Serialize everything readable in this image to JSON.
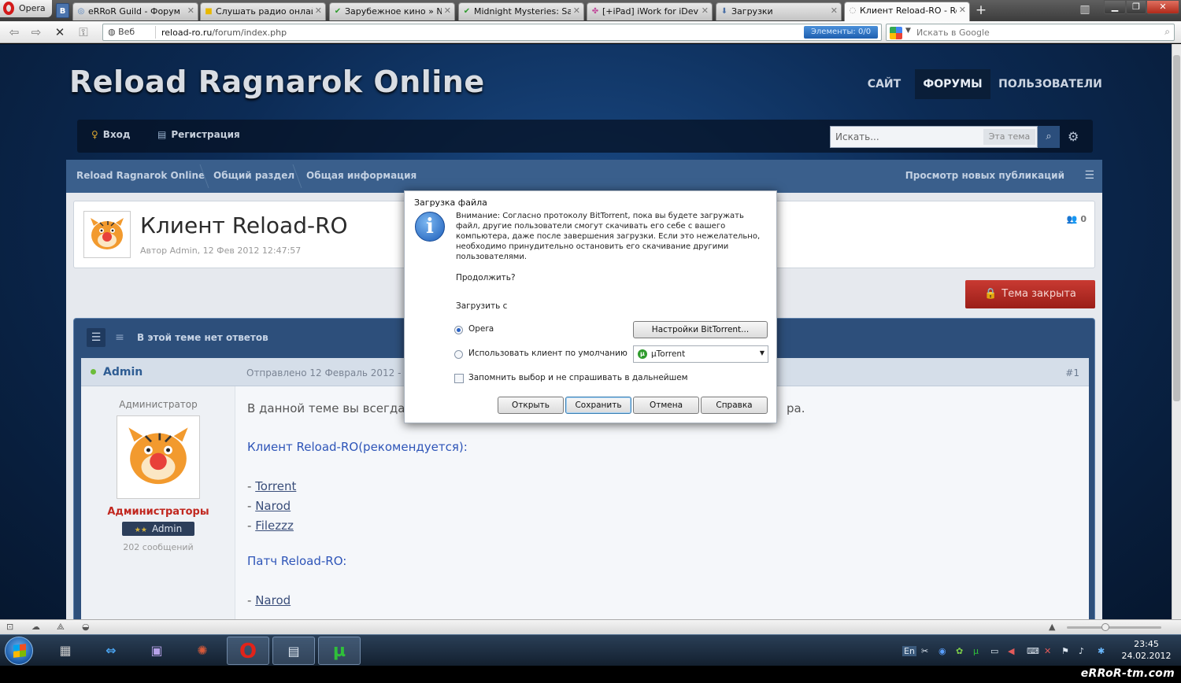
{
  "browser": {
    "menu_label": "Opera",
    "vk_label": "B",
    "tabs": [
      {
        "label": "eRRoR Guild - Форум",
        "icon": "globe-icon",
        "active": false
      },
      {
        "label": "Слушать радио онлай...",
        "icon": "folder-icon",
        "active": false
      },
      {
        "label": "Зарубежное кино » N...",
        "icon": "check-icon",
        "active": false
      },
      {
        "label": "Midnight Mysteries: Sal...",
        "icon": "check-icon",
        "active": false
      },
      {
        "label": "[+iPad] iWork for iDevi...",
        "icon": "puzzle-icon",
        "active": false
      },
      {
        "label": "Загрузки",
        "icon": "download-icon",
        "active": false
      },
      {
        "label": "Клиент Reload-RO - Re...",
        "icon": "loading-icon",
        "active": true
      }
    ],
    "address": {
      "web_label": "Веб",
      "url_domain": "reload-ro.ru",
      "url_path": "/forum/index.php",
      "elements_badge": "Элементы: 0/0"
    },
    "search": {
      "placeholder": "Искать в Google"
    }
  },
  "site": {
    "title": "Reload Ragnarok Online",
    "nav": [
      {
        "label": "САЙТ",
        "active": false
      },
      {
        "label": "ФОРУМЫ",
        "active": true
      },
      {
        "label": "ПОЛЬЗОВАТЕЛИ",
        "active": false
      }
    ],
    "login_label": "Вход",
    "register_label": "Регистрация",
    "search_placeholder": "Искать...",
    "search_scope": "Эта тема",
    "breadcrumb": [
      "Reload Ragnarok Online",
      "Общий раздел",
      "Общая информация"
    ],
    "new_posts_label": "Просмотр новых публикаций"
  },
  "topic": {
    "title": "Клиент Reload-RO",
    "meta": "Автор Admin, 12 Фев 2012 12:47:57",
    "viewers": "0",
    "closed_label": "Тема закрыта",
    "no_replies": "В этой теме нет ответов"
  },
  "post": {
    "author": "Admin",
    "date": "Отправлено 12 Февраль 2012 - 12",
    "number": "#1",
    "role_title": "Администратор",
    "group": "Администраторы",
    "rank": "Admin",
    "post_count": "202 сообщений",
    "intro_start": "В данной теме вы всегда",
    "intro_end": "ра.",
    "client_heading": "Клиент Reload-RO(рекомендуется):",
    "client_links": [
      "Torrent",
      "Narod",
      "Filezzz"
    ],
    "patch_heading": "Патч Reload-RO:",
    "patch_links": [
      "Narod"
    ]
  },
  "dialog": {
    "title": "Загрузка файла",
    "message": "Внимание: Согласно протоколу BitTorrent, пока вы будете загружать файл, другие пользователи смогут скачивать его себе с вашего компьютера, даже после завершения загрузки. Если это нежелательно, необходимо принудительно остановить его скачивание другими пользователями.",
    "question": "Продолжить?",
    "download_from": "Загрузить с",
    "option_opera": "Opera",
    "option_default": "Использовать клиент по умолчанию",
    "bt_settings": "Настройки BitTorrent...",
    "client": "µTorrent",
    "remember": "Запомнить выбор и не спрашивать в дальнейшем",
    "buttons": {
      "open": "Открыть",
      "save": "Сохранить",
      "cancel": "Отмена",
      "help": "Справка"
    }
  },
  "taskbar": {
    "lang": "En",
    "time": "23:45",
    "date": "24.02.2012"
  },
  "watermark": "eRRoR-tm.com",
  "colors": {
    "accent": "#2f5d93",
    "closed": "#b02a22",
    "page_bg": "#0c2b55"
  }
}
